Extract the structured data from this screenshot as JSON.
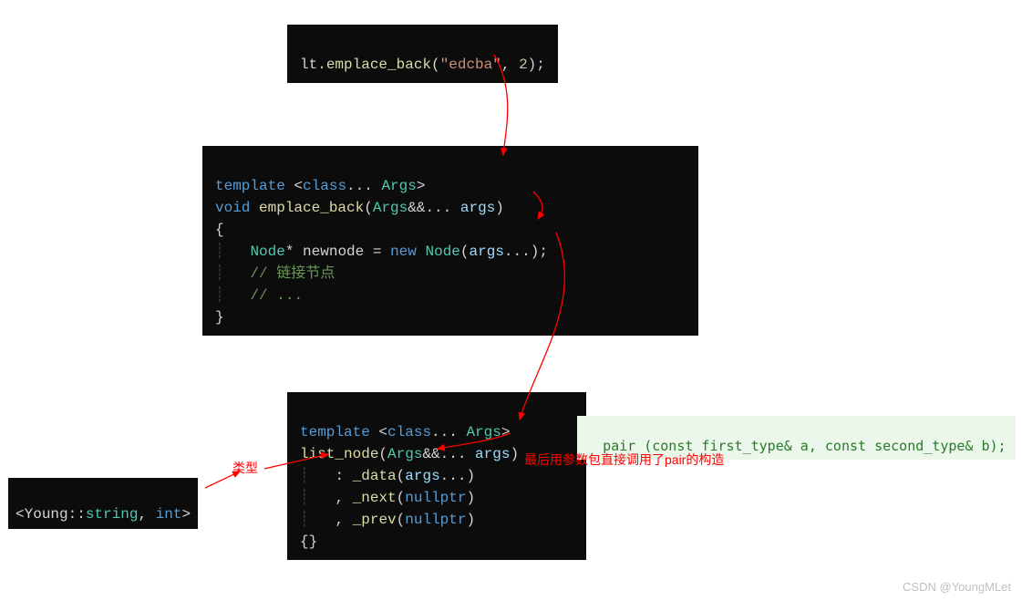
{
  "block1": {
    "prefix": "lt.",
    "fn": "emplace_back",
    "lparen": "(",
    "str": "\"edcba\"",
    "comma": ", ",
    "num": "2",
    "rparen_semi": ");"
  },
  "block2": {
    "line1": {
      "template": "template ",
      "lt": "<",
      "class": "class",
      "dots": "... ",
      "Args": "Args",
      "gt": ">"
    },
    "line2": {
      "void": "void",
      "sp": " ",
      "fn": "emplace_back",
      "lparen": "(",
      "Args": "Args",
      "amp": "&&... ",
      "args": "args",
      "rparen": ")"
    },
    "lbrace": "{",
    "line4": {
      "indent_guide": "┊   ",
      "Node": "Node",
      "star": "* ",
      "newnode": "newnode",
      "eq": " = ",
      "new": "new",
      "sp2": " ",
      "NodeCtor": "Node",
      "lparen": "(",
      "args": "args",
      "dots": "...",
      "rparen_semi": ");"
    },
    "line5": {
      "indent_guide": "┊   ",
      "comment": "// 链接节点"
    },
    "line6": {
      "indent_guide": "┊   ",
      "comment": "// ..."
    },
    "rbrace": "}"
  },
  "block3": {
    "line1": {
      "template": "template ",
      "lt": "<",
      "class": "class",
      "dots": "... ",
      "Args": "Args",
      "gt": ">"
    },
    "line2": {
      "fn": "list_node",
      "lparen": "(",
      "Args": "Args",
      "amp": "&&... ",
      "args": "args",
      "rparen": ")"
    },
    "line3": {
      "indent_guide": "┊   ",
      "colon": ": ",
      "field": "_data",
      "lparen": "(",
      "args": "args",
      "dots": "...",
      "rparen": ")"
    },
    "line4": {
      "indent_guide": "┊   ",
      "comma": ", ",
      "field": "_next",
      "lparen": "(",
      "null": "nullptr",
      "rparen": ")"
    },
    "line5": {
      "indent_guide": "┊   ",
      "comma": ", ",
      "field": "_prev",
      "lparen": "(",
      "null": "nullptr",
      "rparen": ")"
    },
    "braces": "{}"
  },
  "type_block": {
    "lb": "<",
    "ns": "Young::",
    "t1": "string",
    "comma": ", ",
    "t2": "int",
    "rb": ">"
  },
  "annotations": {
    "leixing": "类型",
    "pair_call": "最后用参数包直接调用了pair的构造"
  },
  "pair_sig": "pair (const first_type& a, const second_type& b);",
  "watermark": "CSDN @YoungMLet"
}
